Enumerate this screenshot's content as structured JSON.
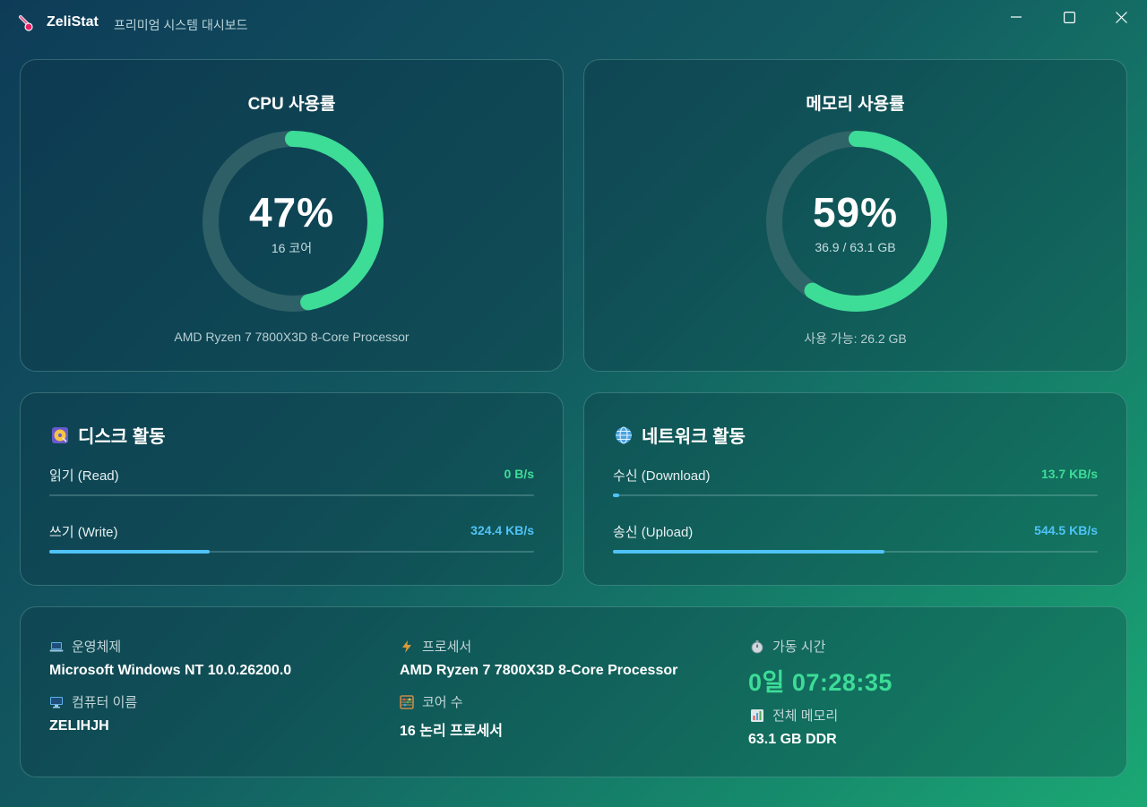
{
  "window": {
    "app_name": "ZeliStat",
    "subtitle": "프리미엄 시스템 대시보드",
    "icon": "thermometer-icon",
    "controls": [
      "minimize-icon",
      "maximize-icon",
      "close-icon"
    ]
  },
  "cpu": {
    "title": "CPU 사용률",
    "percent_label": "47%",
    "percent": 47,
    "sub": "16 코어",
    "model": "AMD Ryzen 7 7800X3D 8-Core Processor"
  },
  "memory": {
    "title": "메모리 사용률",
    "percent_label": "59%",
    "percent": 59,
    "sub": "36.9 / 63.1 GB",
    "available": "사용 가능: 26.2 GB"
  },
  "disk": {
    "title": "디스크 활동",
    "icon": "disk-icon",
    "read_label": "읽기 (Read)",
    "read_value": "0 B/s",
    "read_fraction": 0.0,
    "write_label": "쓰기 (Write)",
    "write_value": "324.4 KB/s",
    "write_fraction": 0.33
  },
  "network": {
    "title": "네트워크 활동",
    "icon": "globe-icon",
    "down_label": "수신 (Download)",
    "down_value": "13.7 KB/s",
    "down_fraction": 0.006,
    "up_label": "송신 (Upload)",
    "up_value": "544.5 KB/s",
    "up_fraction": 0.56
  },
  "info": {
    "os_label": "운영체제",
    "os_value": "Microsoft Windows NT 10.0.26200.0",
    "computer_label": "컴퓨터 이름",
    "computer_value": "ZELIHJH",
    "processor_label": "프로세서",
    "processor_value": "AMD Ryzen 7 7800X3D 8-Core Processor",
    "cores_label": "코어 수",
    "cores_value": "16 논리 프로세서",
    "uptime_label": "가동 시간",
    "uptime_value": "0일 07:28:35",
    "total_mem_label": "전체 메모리",
    "total_mem_value": "63.1 GB DDR"
  },
  "colors": {
    "accent_green": "#3ddc97",
    "accent_blue": "#4fc3f7",
    "track": "#3a6a6e"
  }
}
